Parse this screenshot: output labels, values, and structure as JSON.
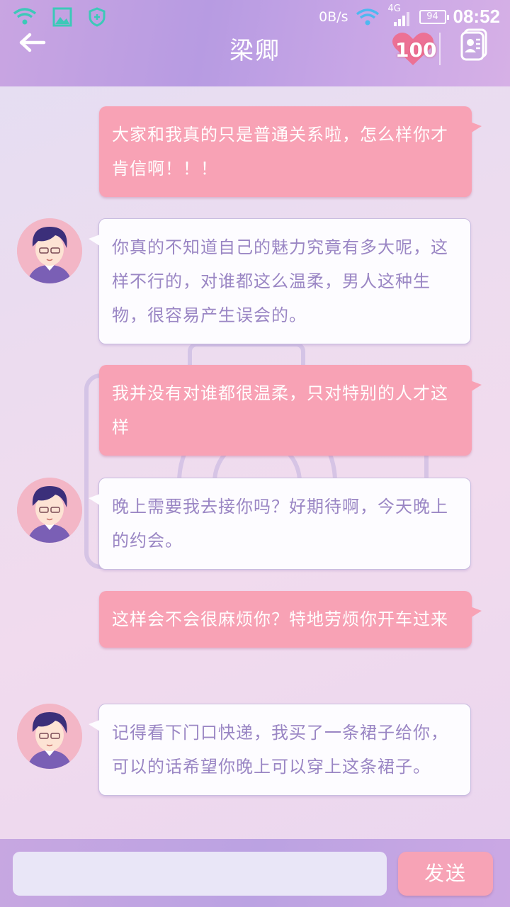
{
  "status_bar": {
    "net_speed": "0B/s",
    "signal_label": "4G",
    "battery": "94",
    "time": "08:52"
  },
  "header": {
    "title": "梁卿",
    "affection_value": "100"
  },
  "messages": [
    {
      "sender": "me",
      "text": "大家和我真的只是普通关系啦，怎么样你才肯信啊！！！"
    },
    {
      "sender": "him",
      "text": "你真的不知道自己的魅力究竟有多大呢，这样不行的，对谁都这么温柔，男人这种生物，很容易产生误会的。"
    },
    {
      "sender": "me",
      "text": "我并没有对谁都很温柔，只对特别的人才这样"
    },
    {
      "sender": "him",
      "text": "晚上需要我去接你吗？好期待啊，今天晚上的约会。"
    },
    {
      "sender": "me",
      "text": "这样会不会很麻烦你？特地劳烦你开车过来"
    },
    {
      "sender": "him",
      "text": "记得看下门口快递，我买了一条裙子给你，可以的话希望你晚上可以穿上这条裙子。"
    }
  ],
  "input": {
    "value": "",
    "send_label": "发送"
  },
  "colors": {
    "my_bubble": "#f8a2b5",
    "his_bubble": "#fdfcff",
    "his_text": "#9a86c4",
    "header": "#b79be2"
  }
}
